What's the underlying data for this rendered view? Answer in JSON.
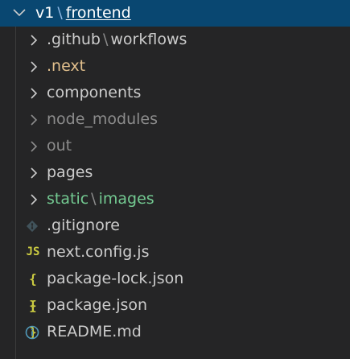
{
  "root": {
    "parent": "v1",
    "separator": "\\",
    "name": "frontend"
  },
  "items": [
    {
      "type": "folder",
      "label": ".github",
      "separator": "\\",
      "label2": "workflows",
      "tone": "normal"
    },
    {
      "type": "folder",
      "label": ".next",
      "tone": "modified"
    },
    {
      "type": "folder",
      "label": "components",
      "tone": "normal"
    },
    {
      "type": "folder",
      "label": "node_modules",
      "tone": "ignored"
    },
    {
      "type": "folder",
      "label": "out",
      "tone": "ignored"
    },
    {
      "type": "folder",
      "label": "pages",
      "tone": "normal"
    },
    {
      "type": "folder",
      "label": "static",
      "separator": "\\",
      "label2": "images",
      "tone": "added"
    },
    {
      "type": "file",
      "label": ".gitignore",
      "icon": "git-icon"
    },
    {
      "type": "file",
      "label": "next.config.js",
      "icon": "js-icon",
      "icon_text": "JS"
    },
    {
      "type": "file",
      "label": "package-lock.json",
      "icon": "json-icon",
      "icon_text": "{ }"
    },
    {
      "type": "file",
      "label": "package.json",
      "icon": "json-icon",
      "icon_text": "{ }"
    },
    {
      "type": "file",
      "label": "README.md",
      "icon": "info-icon"
    }
  ],
  "colors": {
    "selected_bg": "#094771",
    "panel_bg": "#252526",
    "text": "#cccccc",
    "modified": "#e2c08d",
    "ignored": "#8c8c8c",
    "added": "#73c991",
    "json_icon": "#cbcb41",
    "info_icon": "#519aba"
  }
}
